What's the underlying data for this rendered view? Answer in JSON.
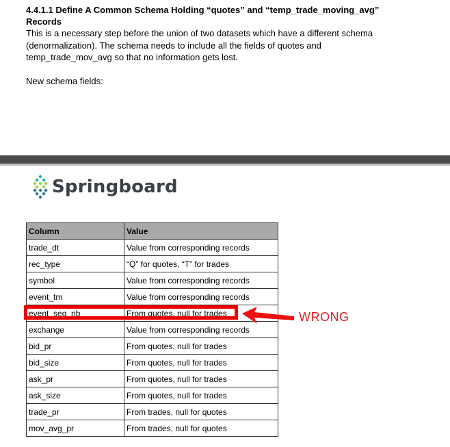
{
  "doc": {
    "heading_line1": "4.4.1.1 Define A Common Schema Holding “quotes” and “temp_trade_moving_avg”",
    "heading_line2": "Records",
    "para_line1": "This is a necessary step before the union of two datasets which have a different schema",
    "para_line2": "(denormalization). The schema needs to include all the fields of quotes and",
    "para_line3": "temp_trade_mov_avg so that no information gets lost.",
    "new_schema": "New schema fields:"
  },
  "logo": {
    "name": "Springboard",
    "icon": "springboard-leaf-icon",
    "colors": [
      "#1fb3a4",
      "#9ed14b",
      "#2a7a8c"
    ]
  },
  "table": {
    "headers": [
      "Column",
      "Value"
    ],
    "rows": [
      [
        "trade_dt",
        "Value from corresponding records"
      ],
      [
        "rec_type",
        "“Q” for quotes, “T” for trades"
      ],
      [
        "symbol",
        "Value from corresponding records"
      ],
      [
        "event_tm",
        "Value from corresponding records"
      ],
      [
        "event_seq_nb",
        "From quotes, null for trades"
      ],
      [
        "exchange",
        "Value from corresponding records"
      ],
      [
        "bid_pr",
        "From quotes, null for trades"
      ],
      [
        "bid_size",
        "From quotes, null for trades"
      ],
      [
        "ask_pr",
        "From quotes, null for trades"
      ],
      [
        "ask_size",
        "From quotes, null for trades"
      ],
      [
        "trade_pr",
        "From trades, null for quotes"
      ],
      [
        "mov_avg_pr",
        "From trades, null for quotes"
      ]
    ]
  },
  "annotation": {
    "label": "WRONG",
    "color": "#e02020",
    "highlighted_row": "event_seq_nb"
  }
}
